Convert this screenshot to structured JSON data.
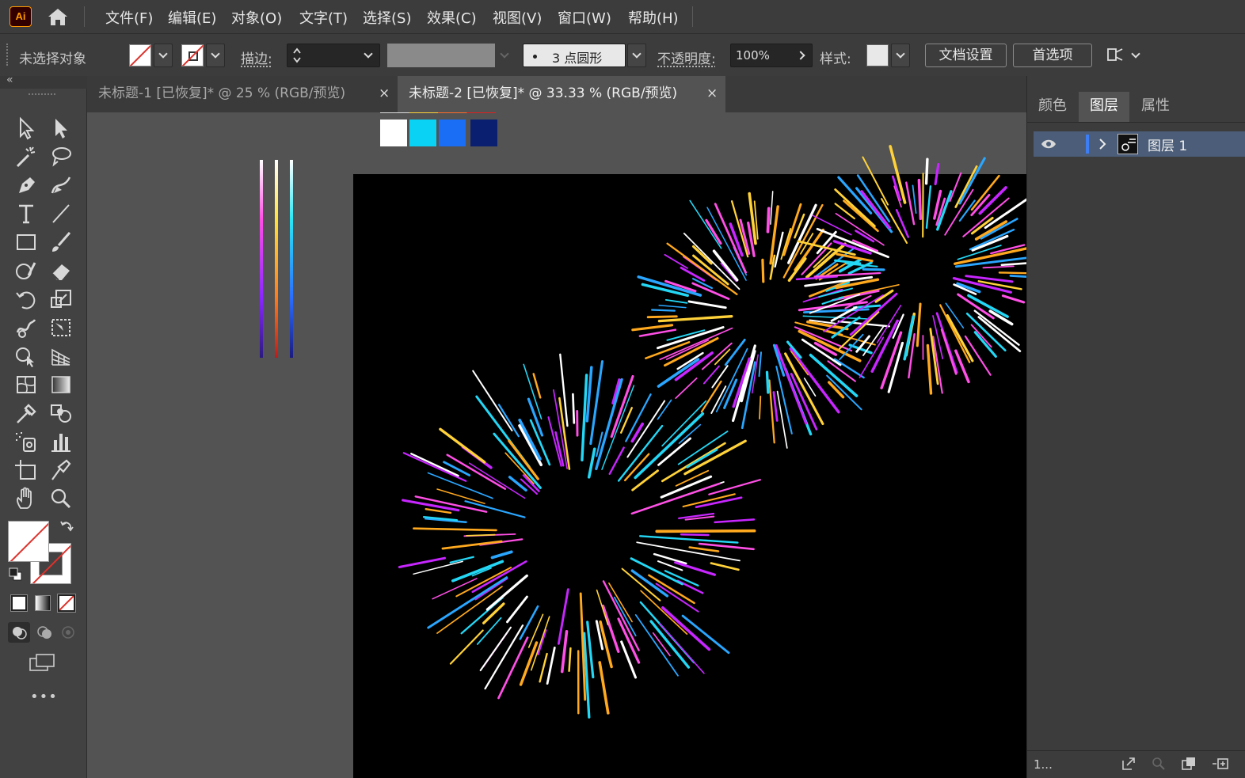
{
  "app": {
    "logo": "Ai"
  },
  "menu": [
    "文件(F)",
    "编辑(E)",
    "对象(O)",
    "文字(T)",
    "选择(S)",
    "效果(C)",
    "视图(V)",
    "窗口(W)",
    "帮助(H)"
  ],
  "control_bar": {
    "selection_status": "未选择对象",
    "stroke_label": "描边:",
    "brush_value": "3 点圆形",
    "opacity_label": "不透明度:",
    "opacity_value": "100%",
    "style_label": "样式:",
    "doc_setup_button": "文档设置",
    "preferences_button": "首选项"
  },
  "tabs": [
    {
      "label": "未标题-1 [已恢复]* @ 25 % (RGB/预览)",
      "active": false
    },
    {
      "label": "未标题-2 [已恢复]* @ 33.33 % (RGB/预览)",
      "active": true
    }
  ],
  "tab_close": "×",
  "panel": {
    "tabs": [
      "颜色",
      "图层",
      "属性"
    ],
    "active_tab": "图层",
    "layers": [
      {
        "name": "图层 1"
      }
    ],
    "layer_count": "1...",
    "layer_color": "#3d7ef5"
  },
  "swatches": [
    "#ffffff",
    "#0ad2f5",
    "#1a6df5",
    "#0a1f70"
  ],
  "toolbar": {
    "more": "•••"
  },
  "colors": {
    "firework_palette": [
      "#ff4fe6",
      "#c726ff",
      "#ffd23a",
      "#ffa91f",
      "#24d7f5",
      "#2aa6ff",
      "#ffffff"
    ]
  }
}
